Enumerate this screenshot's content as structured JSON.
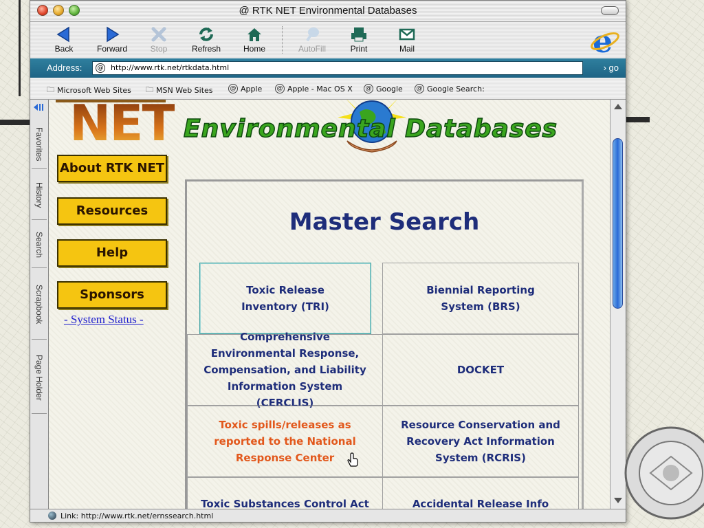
{
  "window": {
    "title": "RTK NET Environmental Databases"
  },
  "toolbar": {
    "back": "Back",
    "forward": "Forward",
    "stop": "Stop",
    "refresh": "Refresh",
    "home": "Home",
    "autofill": "AutoFill",
    "print": "Print",
    "mail": "Mail"
  },
  "address": {
    "label": "Address:",
    "url": "http://www.rtk.net/rtkdata.html",
    "go": "go"
  },
  "favorites": [
    "Microsoft Web Sites",
    "MSN Web Sites",
    "Apple",
    "Apple - Mac OS X",
    "Google",
    "Google Search:"
  ],
  "side_tabs": [
    "Favorites",
    "History",
    "Search",
    "Scrapbook",
    "Page Holder"
  ],
  "page": {
    "logo": "NET",
    "heading": "Environmental Databases",
    "nav": [
      "About RTK NET",
      "Resources",
      "Help",
      "Sponsors"
    ],
    "status_link": "- System Status -",
    "master_title": "Master Search",
    "cells": [
      {
        "text": "Toxic Release\nInventory (TRI)",
        "color": "#1e2d7a"
      },
      {
        "text": "Biennial Reporting\nSystem (BRS)",
        "color": "#1e2d7a"
      },
      {
        "text": "Comprehensive\nEnvironmental Response,\nCompensation, and Liability\nInformation System (CERCLIS)",
        "color": "#1e2d7a"
      },
      {
        "text": "DOCKET",
        "color": "#1e2d7a"
      },
      {
        "text": "Toxic spills/releases as\nreported to the National\nResponse Center",
        "color": "#e2581c"
      },
      {
        "text": "Resource Conservation and\nRecovery Act Information\nSystem (RCRIS)",
        "color": "#1e2d7a"
      },
      {
        "text": "Toxic Substances Control Act",
        "color": "#1e2d7a"
      },
      {
        "text": "Accidental Release Info",
        "color": "#1e2d7a"
      }
    ]
  },
  "statusbar": {
    "text": "Link: http://www.rtk.net/ernssearch.html"
  }
}
